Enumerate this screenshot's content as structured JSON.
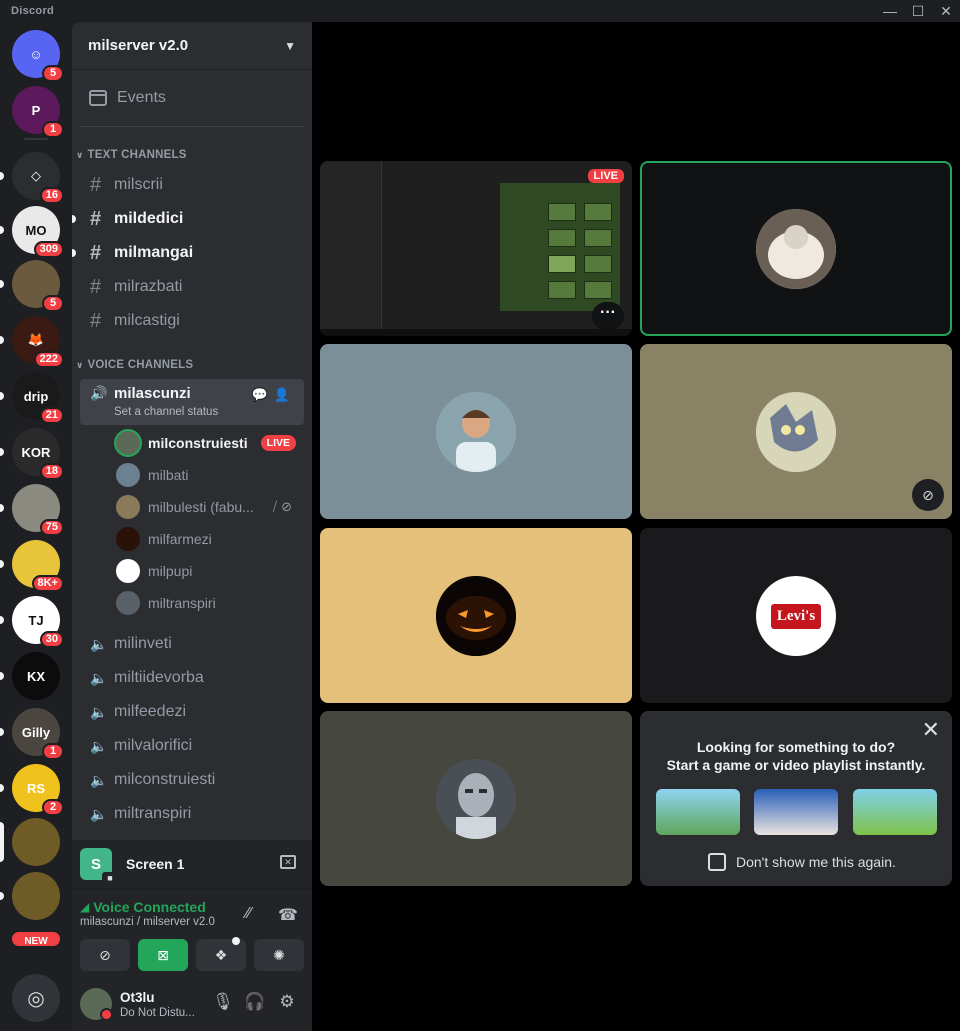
{
  "app": {
    "title": "Discord",
    "window_controls": [
      "—",
      "☐",
      "✕"
    ]
  },
  "servers": [
    {
      "name": "discord-home",
      "badge": "5",
      "color": "#5865f2",
      "label": "☺"
    },
    {
      "name": "server-p",
      "badge": "1",
      "color": "#5c1a5c",
      "label": "P"
    },
    {
      "name": "server-diamond",
      "badge": "16",
      "color": "#2b2d31",
      "label": "◇"
    },
    {
      "name": "server-mo",
      "badge": "309",
      "color": "#e9e9e9",
      "label": "MO"
    },
    {
      "name": "server-wood",
      "badge": "5",
      "color": "#6b5a3e",
      "label": ""
    },
    {
      "name": "server-fox",
      "badge": "222",
      "color": "#3a1a12",
      "label": "🦊"
    },
    {
      "name": "server-drip",
      "badge": "21",
      "color": "#1a1a1a",
      "label": "drip"
    },
    {
      "name": "server-kor",
      "badge": "18",
      "color": "#2a2a2a",
      "label": "KOR"
    },
    {
      "name": "server-face",
      "badge": "75",
      "color": "#8a8a80",
      "label": ""
    },
    {
      "name": "server-shoe",
      "badge": "8K+",
      "color": "#e8c43a",
      "label": ""
    },
    {
      "name": "server-tj",
      "badge": "30",
      "color": "#ffffff",
      "label": "TJ"
    },
    {
      "name": "server-kx",
      "badge": "",
      "color": "#0c0c0c",
      "label": "KX"
    },
    {
      "name": "server-gilly",
      "badge": "1",
      "color": "#4c4640",
      "label": "Gilly"
    },
    {
      "name": "server-rs",
      "badge": "2",
      "color": "#f0c21d",
      "label": "RS"
    },
    {
      "name": "server-gold-1",
      "badge": "",
      "color": "#6e5b26",
      "label": ""
    },
    {
      "name": "server-gold-2",
      "badge": "",
      "color": "#6e5b26",
      "label": ""
    }
  ],
  "new_badge": "NEW",
  "server_name": "milserver v2.0",
  "events_label": "Events",
  "text_category": "TEXT CHANNELS",
  "text_channels": [
    {
      "name": "milscrii",
      "unread": false
    },
    {
      "name": "mildedici",
      "unread": true
    },
    {
      "name": "milmangai",
      "unread": true
    },
    {
      "name": "milrazbati",
      "unread": false
    },
    {
      "name": "milcastigi",
      "unread": false
    }
  ],
  "voice_category": "VOICE CHANNELS",
  "active_voice": {
    "name": "milascunzi",
    "status": "Set a channel status",
    "members": [
      {
        "name": "milconstruiesti",
        "live": "LIVE",
        "color": "#5b6a57",
        "me": true
      },
      {
        "name": "milbati",
        "color": "#6c8190"
      },
      {
        "name": "milbulesti (fabu...",
        "color": "#8a7a5a",
        "muted": true
      },
      {
        "name": "milfarmezi",
        "color": "#2a1208"
      },
      {
        "name": "milpupi",
        "color": "#ffffff"
      },
      {
        "name": "miltranspiri",
        "color": "#5a6068"
      }
    ]
  },
  "voice_channels": [
    "milinveti",
    "miltiidevorba",
    "milfeedezi",
    "milvalorifici",
    "milconstruiesti",
    "miltranspiri"
  ],
  "stream": {
    "letter": "S",
    "label": "Screen 1"
  },
  "voice_panel": {
    "status": "Voice Connected",
    "location": "milascunzi / milserver v2.0"
  },
  "user": {
    "name": "Ot3lu",
    "status": "Do Not Distu..."
  },
  "tiles": {
    "live": "LIVE",
    "prompt_line1": "Looking for something to do?",
    "prompt_line2": "Start a game or video playlist instantly.",
    "prompt_checkbox": "Don't show me this again.",
    "levis_label": "Levi's"
  },
  "colors": {
    "accent": "#5865f2",
    "danger": "#f23f43",
    "online": "#23a55a",
    "tile_blue": "#7b8f99",
    "tile_olive": "#8a8264",
    "tile_tan": "#e5c07a",
    "tile_dark": "#1a1a1c",
    "tile_grey": "#46473f"
  }
}
